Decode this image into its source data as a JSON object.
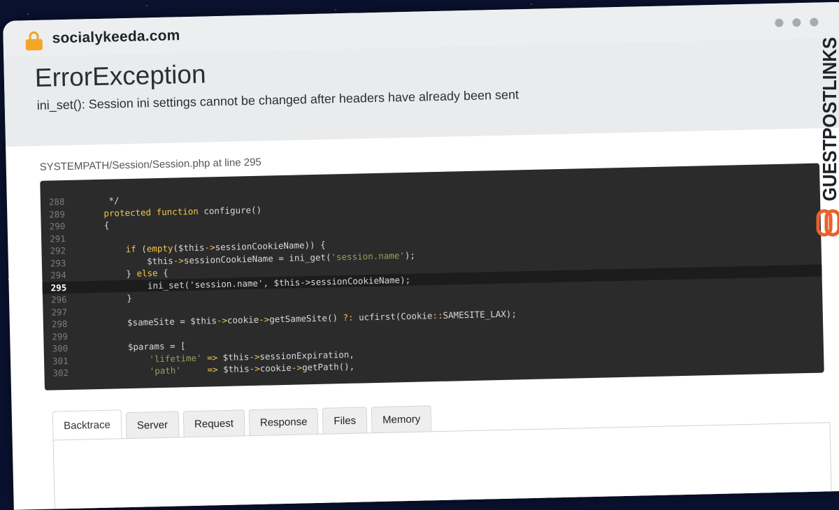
{
  "browser": {
    "domain": "socialykeeda.com",
    "lock_icon": "lock-icon",
    "window_controls": [
      "dot",
      "dot",
      "dot"
    ]
  },
  "error": {
    "title": "ErrorException",
    "message": "ini_set(): Session ini settings cannot be changed after headers have already been sent",
    "location": "SYSTEMPATH/Session/Session.php at line 295"
  },
  "code": {
    "highlight_line": "295",
    "lines": [
      {
        "num": "288",
        "text": "     */"
      },
      {
        "num": "289",
        "text": "    protected function configure()"
      },
      {
        "num": "290",
        "text": "    {"
      },
      {
        "num": "291",
        "text": ""
      },
      {
        "num": "292",
        "text": "        if (empty($this->sessionCookieName)) {"
      },
      {
        "num": "293",
        "text": "            $this->sessionCookieName = ini_get('session.name');"
      },
      {
        "num": "294",
        "text": "        } else {"
      },
      {
        "num": "295",
        "text": "            ini_set('session.name', $this->sessionCookieName);"
      },
      {
        "num": "296",
        "text": "        }"
      },
      {
        "num": "297",
        "text": ""
      },
      {
        "num": "298",
        "text": "        $sameSite = $this->cookie->getSameSite() ?: ucfirst(Cookie::SAMESITE_LAX);"
      },
      {
        "num": "299",
        "text": ""
      },
      {
        "num": "300",
        "text": "        $params = ["
      },
      {
        "num": "301",
        "text": "            'lifetime' => $this->sessionExpiration,"
      },
      {
        "num": "302",
        "text": "            'path'     => $this->cookie->getPath(),"
      }
    ]
  },
  "tabs": [
    "Backtrace",
    "Server",
    "Request",
    "Response",
    "Files",
    "Memory"
  ],
  "active_tab": "Backtrace",
  "watermark": {
    "text": "GUESTPOSTLINKS",
    "icon": "link-icon",
    "color": "#e8612c"
  }
}
